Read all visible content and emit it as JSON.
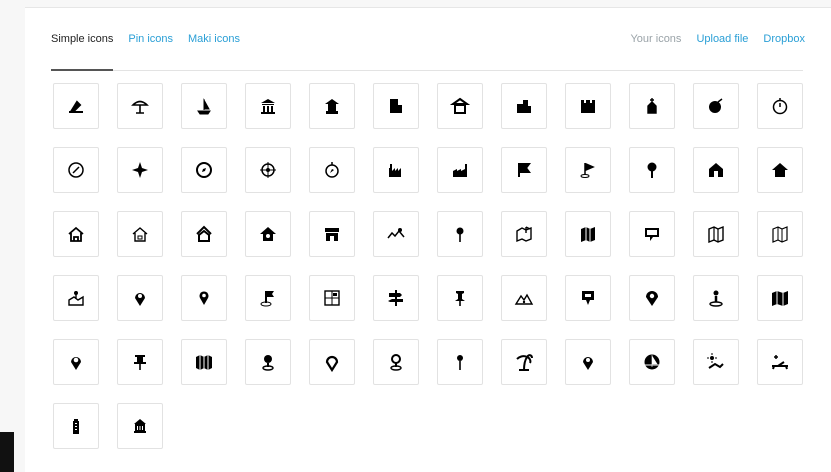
{
  "tabs_left": [
    {
      "label": "Simple icons",
      "active": true
    },
    {
      "label": "Pin icons",
      "active": false
    },
    {
      "label": "Maki icons",
      "active": false
    }
  ],
  "tabs_right": [
    {
      "label": "Your icons"
    },
    {
      "label": "Upload file"
    },
    {
      "label": "Dropbox"
    }
  ],
  "icons": [
    "beach-umbrella-icon",
    "beach-icon",
    "sailboat-icon",
    "bank-icon",
    "museum-icon",
    "office-building-icon",
    "temple-icon",
    "city-buildings-icon",
    "castle-icon",
    "church-icon",
    "cocktail-icon",
    "stopwatch-icon",
    "compass-icon",
    "compass-rose-icon",
    "compass-circle-icon",
    "target-compass-icon",
    "navigation-compass-icon",
    "factory-icon",
    "factory-alt-icon",
    "flag-icon",
    "golf-flag-icon",
    "map-pin-icon",
    "house-window-icon",
    "home-solid-icon",
    "home-outline-icon",
    "home-alt-outline-icon",
    "home-chevron-icon",
    "home-heart-icon",
    "storefront-icon",
    "route-map-icon",
    "pushpin-icon",
    "map-location-icon",
    "map-folded-icon",
    "map-comment-icon",
    "map-outline-icon",
    "map-outline-alt-icon",
    "location-anchor-icon",
    "map-marker-icon",
    "marker-small-icon",
    "flag-pin-icon",
    "city-map-icon",
    "signpost-icon",
    "thumbtack-icon",
    "terrain-map-icon",
    "square-pin-icon",
    "location-pin-icon",
    "person-pin-icon",
    "map-solid-icon",
    "place-marker-icon",
    "push-pin-icon",
    "map-columns-icon",
    "location-dot-icon",
    "pin-outline-icon",
    "map-point-icon",
    "needle-pin-icon",
    "palm-tree-icon",
    "marker-pointed-icon",
    "sail-icon",
    "sun-lounger-icon",
    "lounge-chair-icon",
    "skyscraper-icon",
    "government-building-icon"
  ],
  "accent_color": "#2a9fd6"
}
